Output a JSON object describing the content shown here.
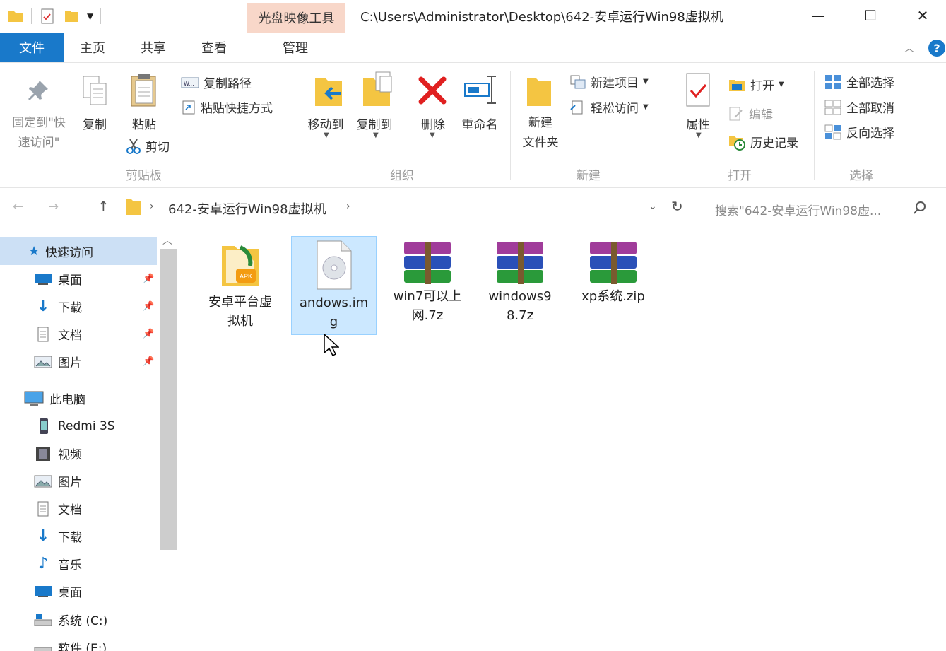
{
  "window": {
    "title": "C:\\Users\\Administrator\\Desktop\\642-安卓运行Win98虚拟机",
    "context_tab": "光盘映像工具",
    "controls": {
      "minimize": "—",
      "maximize": "☐",
      "close": "✕"
    }
  },
  "tabs": [
    {
      "label": "文件",
      "active": true
    },
    {
      "label": "主页",
      "active": false
    },
    {
      "label": "共享",
      "active": false
    },
    {
      "label": "查看",
      "active": false
    },
    {
      "label": "管理",
      "active": false
    }
  ],
  "ribbon": {
    "clipboard": {
      "group_label": "剪贴板",
      "pin_label_1": "固定到\"快",
      "pin_label_2": "速访问\"",
      "copy": "复制",
      "paste": "粘贴",
      "copy_path": "复制路径",
      "paste_shortcut": "粘贴快捷方式",
      "cut": "剪切"
    },
    "organize": {
      "group_label": "组织",
      "move_to": "移动到",
      "copy_to": "复制到",
      "delete": "删除",
      "rename": "重命名"
    },
    "new": {
      "group_label": "新建",
      "new_folder_1": "新建",
      "new_folder_2": "文件夹",
      "new_item": "新建项目",
      "easy_access": "轻松访问"
    },
    "open": {
      "group_label": "打开",
      "properties": "属性",
      "open": "打开",
      "edit": "编辑",
      "history": "历史记录"
    },
    "select": {
      "group_label": "选择",
      "select_all": "全部选择",
      "select_none": "全部取消",
      "invert": "反向选择"
    }
  },
  "address": {
    "path": "642-安卓运行Win98虚拟机",
    "search_placeholder": "搜索\"642-安卓运行Win98虚..."
  },
  "nav": {
    "quick_access": "快速访问",
    "quick_items": [
      "桌面",
      "下载",
      "文档",
      "图片"
    ],
    "this_pc": "此电脑",
    "pc_items": [
      "Redmi 3S",
      "视频",
      "图片",
      "文档",
      "下载",
      "音乐",
      "桌面",
      "系统 (C:)",
      "软件 (E:)"
    ]
  },
  "files": [
    {
      "name_1": "安卓平台虚",
      "name_2": "拟机",
      "type": "apk-folder",
      "selected": false
    },
    {
      "name_1": "andows.im",
      "name_2": "g",
      "type": "disc-image",
      "selected": true
    },
    {
      "name_1": "win7可以上",
      "name_2": "网.7z",
      "type": "rar-archive",
      "selected": false
    },
    {
      "name_1": "windows9",
      "name_2": "8.7z",
      "type": "rar-archive",
      "selected": false
    },
    {
      "name_1": "xp系统.zip",
      "name_2": "",
      "type": "rar-archive",
      "selected": false
    }
  ],
  "colors": {
    "accent": "#1979ca",
    "context_tab": "#f8d7c9",
    "selection": "#cce8ff"
  }
}
